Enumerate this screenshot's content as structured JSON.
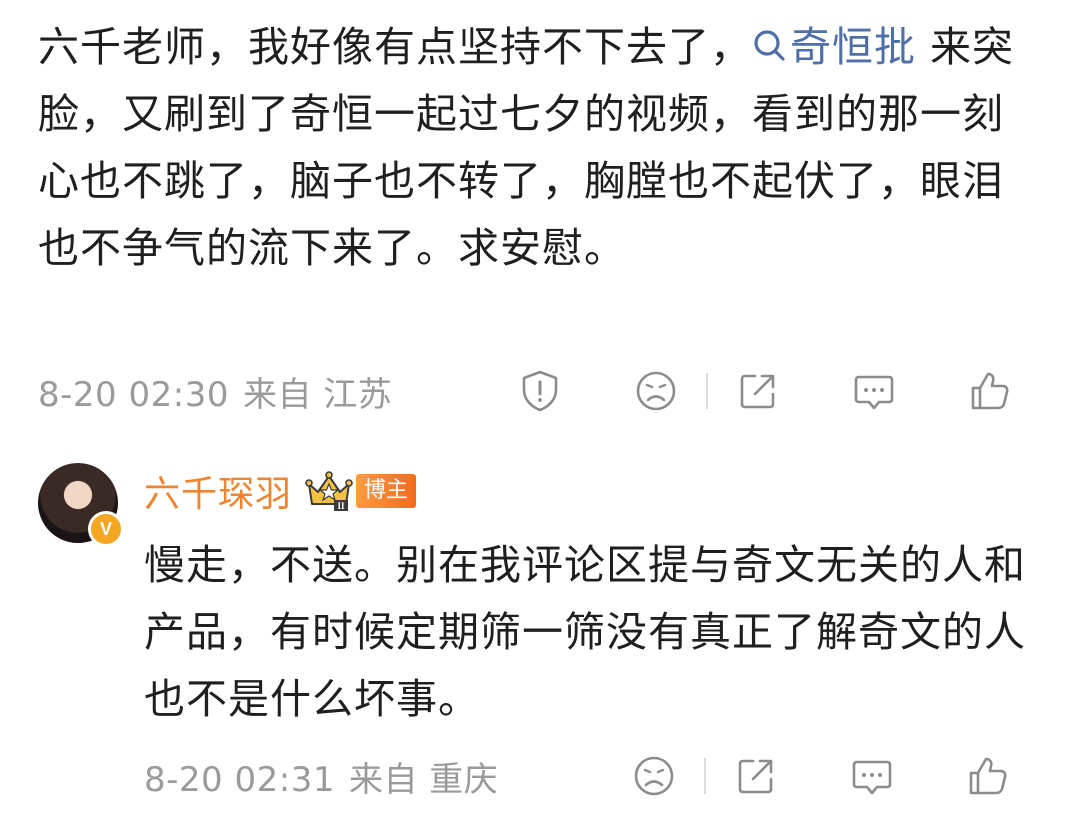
{
  "comment": {
    "text_before_topic": "六千老师，我好像有点坚持不下去了，",
    "topic_label": "奇恒批",
    "text_after_topic": " 来突脸，又刷到了奇恒一起过七夕的视频，看到的那一刻心也不跳了，脑子也不转了，胸膛也不起伏了，眼泪也不争气的流下来了。求安慰。",
    "time": "8-20 02:30",
    "location": "来自 江苏"
  },
  "reply": {
    "username": "六千琛羽",
    "verified_badge": "V",
    "crown_level": "II",
    "role_badge": "博主",
    "text": "慢走，不送。别在我评论区提与奇文无关的人和产品，有时候定期筛一筛没有真正了解奇文的人也不是什么坏事。",
    "time": "8-20 02:31",
    "location": "来自 重庆"
  },
  "icons": {
    "topic": "search-icon",
    "report": "report-icon",
    "dislike": "sad-face-icon",
    "share": "share-icon",
    "comment": "comment-icon",
    "like": "thumbs-up-icon"
  },
  "colors": {
    "link": "#4e6fa8",
    "username": "#f0842e",
    "meta": "#9a9a9a",
    "icon": "#8c8c8c"
  }
}
